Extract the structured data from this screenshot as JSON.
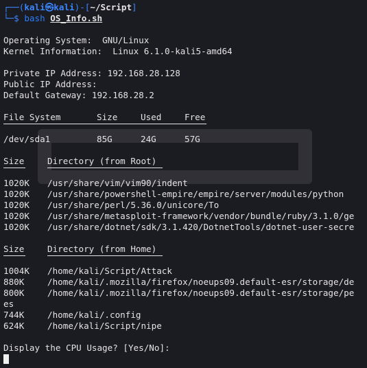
{
  "prompt": {
    "top_left": "┌──(",
    "user": "kali",
    "at": "㉿",
    "host": "kali",
    "mid": ")-[",
    "cwd": "~/Script",
    "end": "]",
    "bottom_left": "└─",
    "dollar": "$ ",
    "cmd": "bash",
    "arg": "OS_Info.sh"
  },
  "sysinfo": {
    "os_label": "Operating System:  ",
    "os_value": "GNU/Linux",
    "kernel_label": "Kernel Information:  ",
    "kernel_value": "Linux 6.1.0-kali5-amd64",
    "private_ip_label": "Private IP Address: ",
    "private_ip_value": "192.168.28.128",
    "public_ip_label": "Public IP Address:",
    "gateway_label": "Default Gateway: ",
    "gateway_value": "192.168.28.2"
  },
  "fs_table": {
    "headers": [
      "File System",
      "Size",
      "Used",
      "Free"
    ],
    "rows": [
      [
        "/dev/sda1",
        "85G",
        "24G",
        "57G"
      ]
    ]
  },
  "root_dirs": {
    "headers": [
      "Size",
      "Directory (from Root)"
    ],
    "rows": [
      [
        "1020K",
        "/usr/share/vim/vim90/indent"
      ],
      [
        "1020K",
        "/usr/share/powershell-empire/empire/server/modules/python"
      ],
      [
        "1020K",
        "/usr/share/perl/5.36.0/unicore/To"
      ],
      [
        "1020K",
        "/usr/share/metasploit-framework/vendor/bundle/ruby/3.1.0/ge"
      ],
      [
        "1020K",
        "/usr/share/dotnet/sdk/3.1.420/DotnetTools/dotnet-user-secre"
      ]
    ]
  },
  "home_dirs": {
    "headers": [
      "Size",
      "Directory (from Home)"
    ],
    "rows": [
      [
        "1004K",
        "/home/kali/Script/Attack"
      ],
      [
        "880K",
        "/home/kali/.mozilla/firefox/noeups09.default-esr/storage/de"
      ],
      [
        "800K",
        "/home/kali/.mozilla/firefox/noeups09.default-esr/storage/pe"
      ],
      [
        "",
        "es"
      ],
      [
        "744K",
        "/home/kali/.config"
      ],
      [
        "624K",
        "/home/kali/Script/nipe"
      ]
    ]
  },
  "question": "Display the CPU Usage? [Yes/No]:",
  "colors": {
    "background": "#1b1b22",
    "foreground": "#e4e4e4",
    "prompt_blue": "#3a86ff"
  }
}
